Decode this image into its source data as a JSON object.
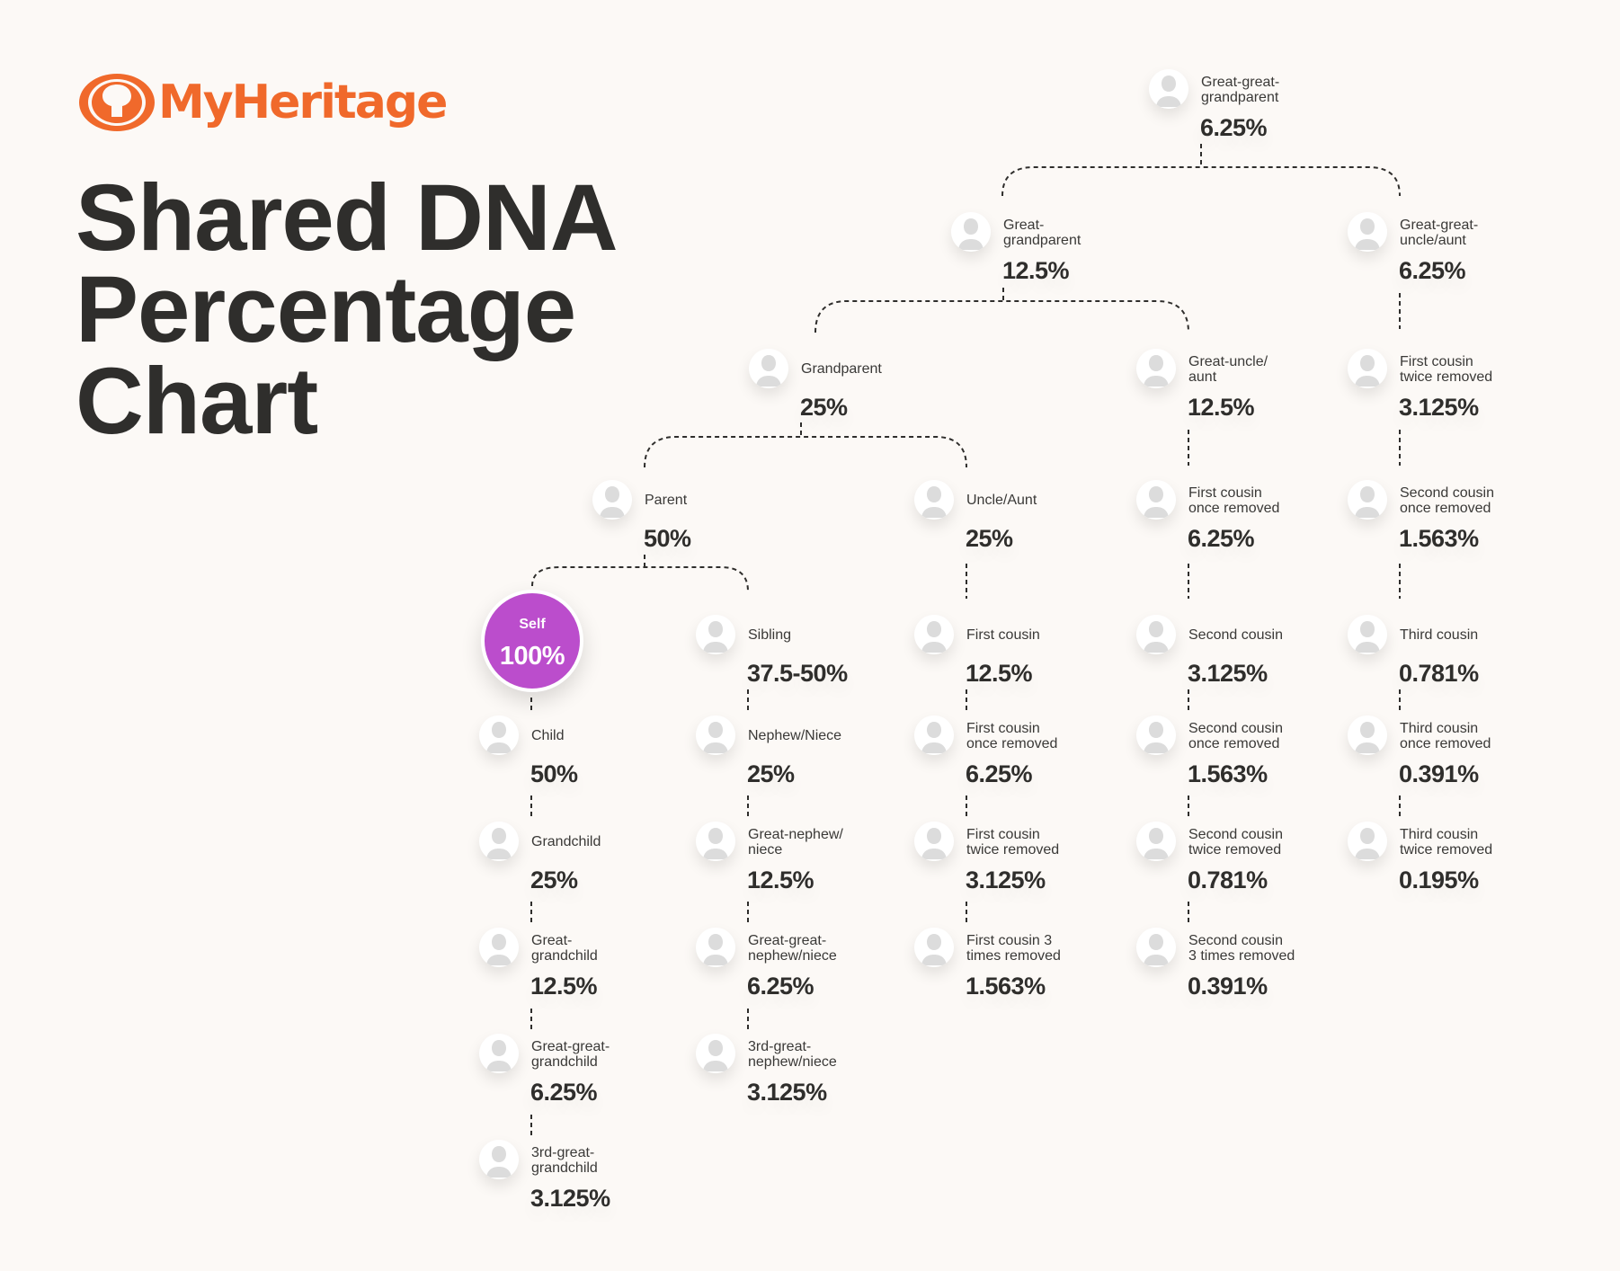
{
  "brand": {
    "name": "MyHeritage",
    "color": "#f0692b"
  },
  "title": {
    "lines": [
      "Shared DNA",
      "Percentage",
      "Chart"
    ]
  },
  "colors": {
    "self": "#bb4dcc",
    "text": "#2f2e2c",
    "background": "#fcf9f6"
  },
  "self": {
    "label": "Self",
    "percent": "100%"
  },
  "chart_data": {
    "type": "table",
    "title": "Shared DNA Percentage Chart",
    "relationships": [
      {
        "id": "ggp",
        "label": "Great-great-\ngrandparent",
        "percent": "6.25%"
      },
      {
        "id": "gg",
        "label": "Great-\ngrandparent",
        "percent": "12.5%"
      },
      {
        "id": "ggua",
        "label": "Great-great-\nuncle/aunt",
        "percent": "6.25%"
      },
      {
        "id": "gp",
        "label": "Grandparent",
        "percent": "25%"
      },
      {
        "id": "gua",
        "label": "Great-uncle/\naunt",
        "percent": "12.5%"
      },
      {
        "id": "fc2r_top",
        "label": "First cousin\ntwice removed",
        "percent": "3.125%"
      },
      {
        "id": "parent",
        "label": "Parent",
        "percent": "50%"
      },
      {
        "id": "ua",
        "label": "Uncle/Aunt",
        "percent": "25%"
      },
      {
        "id": "fc1r_top",
        "label": "First cousin\nonce removed",
        "percent": "6.25%"
      },
      {
        "id": "sc1r_top",
        "label": "Second cousin\nonce removed",
        "percent": "1.563%"
      },
      {
        "id": "sibling",
        "label": "Sibling",
        "percent": "37.5-50%"
      },
      {
        "id": "fc",
        "label": "First cousin",
        "percent": "12.5%"
      },
      {
        "id": "sc",
        "label": "Second cousin",
        "percent": "3.125%"
      },
      {
        "id": "tc",
        "label": "Third cousin",
        "percent": "0.781%"
      },
      {
        "id": "child",
        "label": "Child",
        "percent": "50%"
      },
      {
        "id": "nephew",
        "label": "Nephew/Niece",
        "percent": "25%"
      },
      {
        "id": "fc1r",
        "label": "First cousin\nonce removed",
        "percent": "6.25%"
      },
      {
        "id": "sc1r",
        "label": "Second cousin\nonce removed",
        "percent": "1.563%"
      },
      {
        "id": "tc1r",
        "label": "Third cousin\nonce removed",
        "percent": "0.391%"
      },
      {
        "id": "grandchild",
        "label": "Grandchild",
        "percent": "25%"
      },
      {
        "id": "gnephew",
        "label": "Great-nephew/\nniece",
        "percent": "12.5%"
      },
      {
        "id": "fc2r",
        "label": "First cousin\ntwice removed",
        "percent": "3.125%"
      },
      {
        "id": "sc2r",
        "label": "Second cousin\ntwice removed",
        "percent": "0.781%"
      },
      {
        "id": "tc2r",
        "label": "Third cousin\ntwice removed",
        "percent": "0.195%"
      },
      {
        "id": "ggchild",
        "label": "Great-\ngrandchild",
        "percent": "12.5%"
      },
      {
        "id": "ggnephew",
        "label": "Great-great-\nnephew/niece",
        "percent": "6.25%"
      },
      {
        "id": "fc3r",
        "label": "First cousin 3\ntimes removed",
        "percent": "1.563%"
      },
      {
        "id": "sc3r",
        "label": "Second cousin\n3 times removed",
        "percent": "0.391%"
      },
      {
        "id": "gggchild",
        "label": "Great-great-\ngrandchild",
        "percent": "6.25%"
      },
      {
        "id": "gggnephew",
        "label": "3rd-great-\nnephew/niece",
        "percent": "3.125%"
      },
      {
        "id": "ggggchild",
        "label": "3rd-great-\ngrandchild",
        "percent": "3.125%"
      }
    ]
  }
}
